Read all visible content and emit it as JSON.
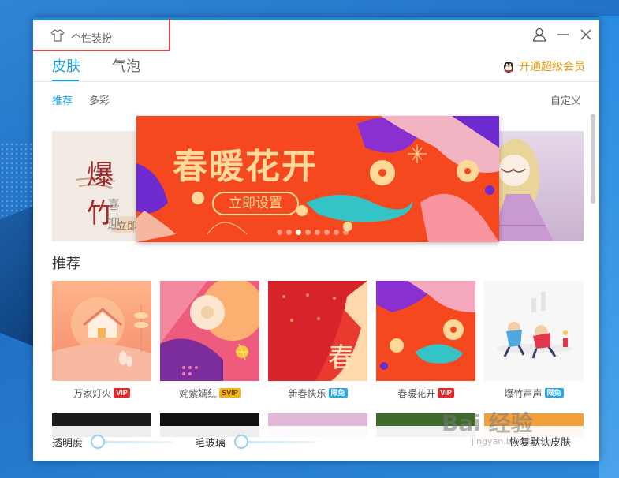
{
  "window": {
    "title": "个性装扮"
  },
  "tabs": [
    {
      "label": "皮肤",
      "active": true
    },
    {
      "label": "气泡",
      "active": false
    }
  ],
  "vip_link": {
    "label": "开通超级会员"
  },
  "subtabs": [
    {
      "label": "推荐",
      "active": true
    },
    {
      "label": "多彩",
      "active": false
    }
  ],
  "custom_label": "自定义",
  "carousel": {
    "banner_title": "春暖花开",
    "banner_button": "立即设置",
    "left_preview": {
      "title": "爆竹",
      "sub": "喜迎",
      "btn": "立即"
    },
    "dot_count": 8,
    "active_dot": 2
  },
  "section_title": "推荐",
  "skins": [
    {
      "name": "万家灯火",
      "badge": "VIP",
      "badge_type": "vip"
    },
    {
      "name": "姹紫嫣红",
      "badge": "SVIP",
      "badge_type": "svip"
    },
    {
      "name": "新春快乐",
      "badge": "限免",
      "badge_type": "free"
    },
    {
      "name": "春暖花开",
      "badge": "VIP",
      "badge_type": "vip"
    },
    {
      "name": "爆竹声声",
      "badge": "限免",
      "badge_type": "free"
    }
  ],
  "thumb_text": {
    "new_year_char": "春"
  },
  "bottom": {
    "opacity_label": "透明度",
    "blur_label": "毛玻璃",
    "opacity_value": 0,
    "blur_value": 0,
    "restore_label": "恢复默认皮肤"
  },
  "watermark": {
    "text": "Bai 经验",
    "sub": "jingyan.baidu.com"
  },
  "colors": {
    "accent": "#16a0e8",
    "vip": "#e79a14",
    "selection_box": "#e04848"
  }
}
